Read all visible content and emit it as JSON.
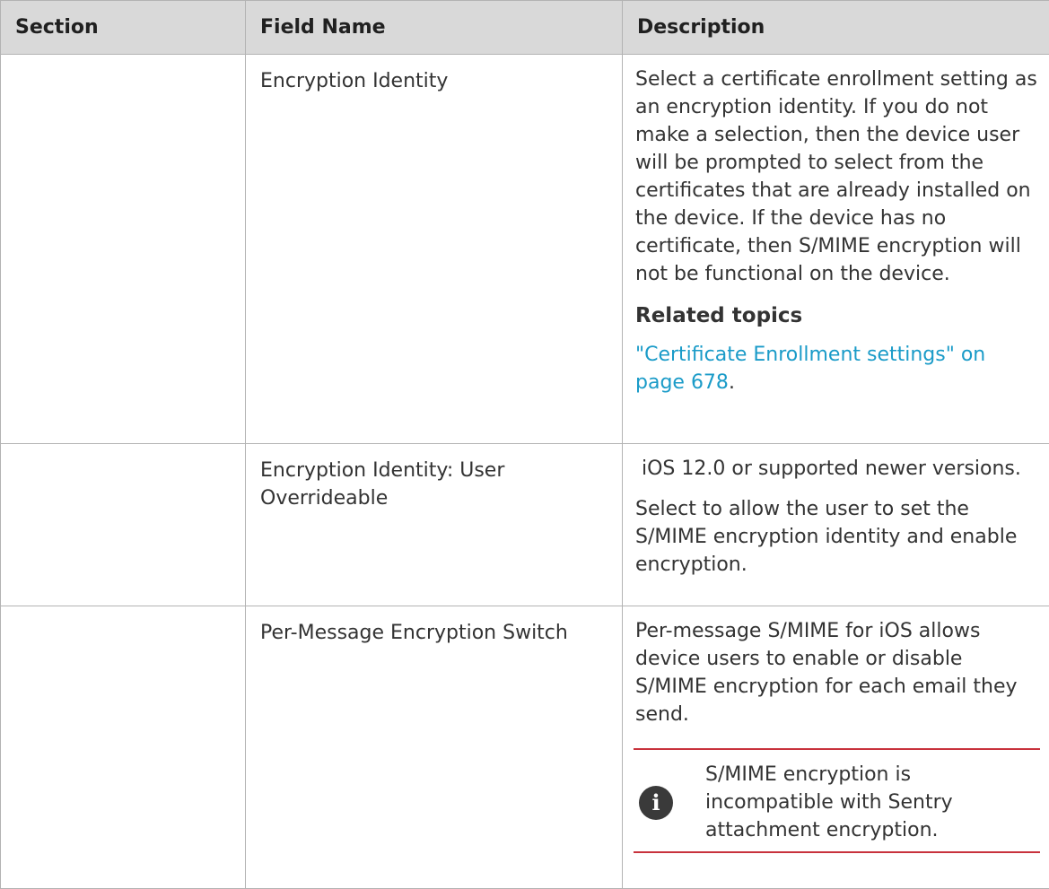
{
  "table": {
    "headers": [
      "Section",
      "Field Name",
      "Description"
    ],
    "rows": [
      {
        "section": "",
        "field": "Encryption Identity",
        "desc": "Select a certificate enrollment setting as an encryption identity. If you do not make a selection, then the device user will be prompted to select from the certificates that are already installed on the device. If the device has no certificate, then S/MIME encryption will not be functional on the device.",
        "related_heading": "Related topics",
        "link": "\"Certificate Enrollment settings\" on page 678",
        "link_suffix": "."
      },
      {
        "section": "",
        "field": "Encryption Identity: User Overrideable",
        "desc_1": " iOS 12.0 or supported newer versions.",
        "desc_2": "Select to allow the user to set the S/MIME encryption identity and enable encryption."
      },
      {
        "section": "",
        "field": "Per-Message Encryption Switch",
        "desc": "Per-message S/MIME for iOS allows device users to enable or disable S/MIME encryption for each email they send.",
        "note_icon": "info-icon",
        "note": "S/MIME encryption is incompatible with Sentry attachment encryption."
      }
    ]
  },
  "colors": {
    "header_bg": "#d9d9d9",
    "link": "#1a9bc8",
    "note_rule": "#c8323c"
  }
}
